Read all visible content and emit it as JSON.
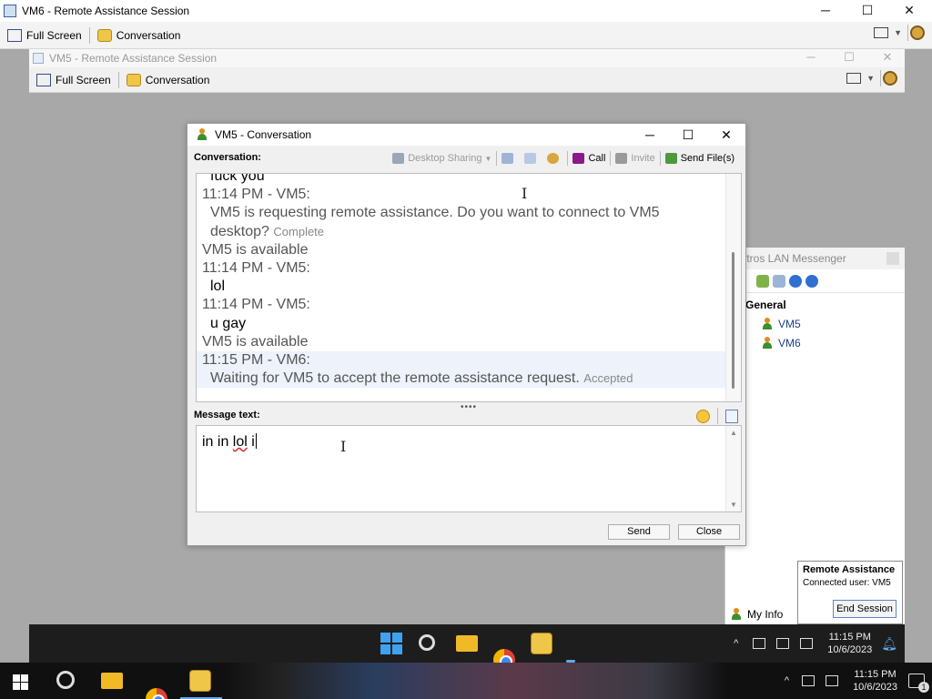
{
  "outer": {
    "title": "VM6 - Remote Assistance Session",
    "toolbar": {
      "full_screen": "Full Screen",
      "conversation": "Conversation"
    },
    "controls": {
      "minimize": "─",
      "maximize": "☐",
      "close": "✕"
    }
  },
  "inner": {
    "title": "VM5 - Remote Assistance Session",
    "toolbar": {
      "full_screen": "Full Screen",
      "conversation": "Conversation"
    },
    "controls": {
      "minimize": "─",
      "maximize": "☐",
      "close": "✕"
    }
  },
  "lan_messenger": {
    "title": "ftros LAN Messenger",
    "group": "General",
    "users": [
      "VM5",
      "VM6"
    ],
    "my_info": "My Info"
  },
  "remote_assistance_panel": {
    "title": "Remote Assistance",
    "connected_user": "Connected user: VM5",
    "end_session": "End Session"
  },
  "conversation_window": {
    "title": "VM5 - Conversation",
    "controls": {
      "minimize": "─",
      "maximize": "☐",
      "close": "✕"
    },
    "conversation_label": "Conversation:",
    "toolbar": {
      "desktop_sharing": "Desktop Sharing",
      "call": "Call",
      "invite": "Invite",
      "send_files": "Send File(s)"
    },
    "history": [
      {
        "kind": "msg",
        "text": "fuck you"
      },
      {
        "kind": "hdr",
        "text": "11:14 PM - VM5:"
      },
      {
        "kind": "sys",
        "text": "VM5 is requesting remote assistance. Do you want to connect to VM5"
      },
      {
        "kind": "sys",
        "text": "desktop?",
        "note": "Complete"
      },
      {
        "kind": "stat",
        "text": "VM5 is available"
      },
      {
        "kind": "hdr",
        "text": "11:14 PM - VM5:"
      },
      {
        "kind": "msg",
        "text": "lol"
      },
      {
        "kind": "hdr",
        "text": "11:14 PM - VM5:"
      },
      {
        "kind": "msg",
        "text": "u gay"
      },
      {
        "kind": "stat",
        "text": "VM5 is available"
      },
      {
        "kind": "hdr",
        "text": "11:15 PM - VM6:",
        "highlight": true
      },
      {
        "kind": "sys",
        "text": "Waiting for VM5 to accept the remote assistance request.",
        "note": "Accepted",
        "highlight": true
      }
    ],
    "message_label": "Message text:",
    "message_text_pre": "in in ",
    "message_text_misspelled": "lol",
    "message_text_post": " i",
    "send": "Send",
    "close": "Close"
  },
  "inner_taskbar": {
    "time": "11:15 PM",
    "date": "10/6/2023",
    "tray_chevron": "^"
  },
  "outer_taskbar": {
    "time": "11:15 PM",
    "date": "10/6/2023",
    "notification_count": "1",
    "tray_chevron": "^"
  }
}
